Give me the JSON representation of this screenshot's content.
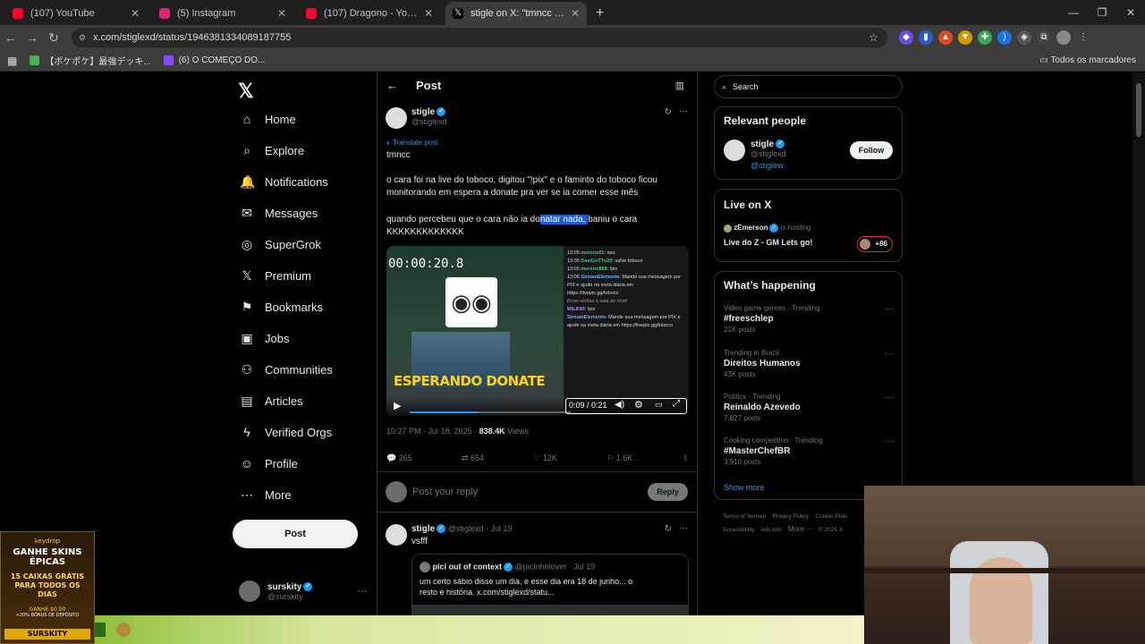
{
  "browser": {
    "tabs": [
      {
        "title": "(107) YouTube",
        "color": "#ff0033"
      },
      {
        "title": "(5) Instagram",
        "color": "#d62976"
      },
      {
        "title": "(107) Dragono - YouTube",
        "color": "#ff0033"
      },
      {
        "title": "stigle on X: \"tmncc o cara foi na",
        "color": "#000000"
      }
    ],
    "url": "x.com/stiglexd/status/1946381334089187755",
    "bookmarks": [
      "【ポケポケ】最強デッキ...",
      "(6) O COMEÇO DO..."
    ],
    "bookmarks_right": "Todos os marcadores"
  },
  "nav": {
    "items": [
      {
        "label": "Home",
        "icon": "⌂"
      },
      {
        "label": "Explore",
        "icon": "⌕"
      },
      {
        "label": "Notifications",
        "icon": "🔔"
      },
      {
        "label": "Messages",
        "icon": "✉"
      },
      {
        "label": "SuperGrok",
        "icon": "◎"
      },
      {
        "label": "Premium",
        "icon": "𝕏"
      },
      {
        "label": "Bookmarks",
        "icon": "⚑"
      },
      {
        "label": "Jobs",
        "icon": "▣"
      },
      {
        "label": "Communities",
        "icon": "⚇"
      },
      {
        "label": "Articles",
        "icon": "▤"
      },
      {
        "label": "Verified Orgs",
        "icon": "ϟ"
      },
      {
        "label": "Profile",
        "icon": "☺"
      },
      {
        "label": "More",
        "icon": "⋯"
      }
    ],
    "post_button": "Post",
    "account": {
      "name": "surskity",
      "handle": "@surskity"
    }
  },
  "header": {
    "title": "Post"
  },
  "post": {
    "name": "stigle",
    "handle": "@stiglexd",
    "translate": "Translate post",
    "line1": "tmncc",
    "line2": "o cara foi na live do toboco, digitou \"!pix\" e o faminto do toboco ficou monitorando em espera a donate pra ver se ia comer esse mês",
    "line3_pre": "quando percebeu que o cara não ia do",
    "line3_hl": "natar nada, ",
    "line3_post": "baniu o cara",
    "line4": "KKKKKKKKKKKKK",
    "video": {
      "timer": "00:00:20.8",
      "banner": "ESPERANDO DONATE",
      "time": "0:09 / 0:21",
      "progress": 0.43,
      "chat": [
        {
          "t": "13:05",
          "u": "moreno01",
          "m": "seu"
        },
        {
          "t": "13:05",
          "u": "DaviGoTTo20",
          "m": "salve toboco"
        },
        {
          "t": "13:05",
          "u": "moreno888",
          "m": "!pix"
        },
        {
          "t": "13:06",
          "u": "StreamElements",
          "m": "Mande sua mensagem por PIX e ajude na meta diária em https://livepix.gg/toboco"
        },
        {
          "t": "",
          "u": "",
          "m": "Boas-vindas à sala de chat!"
        },
        {
          "t": "",
          "u": "MILK00",
          "m": "!pix"
        },
        {
          "t": "",
          "u": "StreamElements",
          "m": "Mande sua mensagem por PIX e ajude na meta diária em https://livepix.gg/toboco"
        }
      ]
    },
    "meta_time": "10:27 PM · Jul 18, 2025 · ",
    "views_count": "838.4K",
    "views_label": " Views",
    "stats": {
      "replies": "265",
      "reposts": "654",
      "likes": "12K",
      "bookmarks": "1.6K"
    },
    "reply_placeholder": "Post your reply",
    "reply_button": "Reply"
  },
  "reply": {
    "name": "stigle",
    "handle": "@stiglexd · Jul 19",
    "text": "vsfff",
    "quote": {
      "name": "pici out of context",
      "handle": "@picInholover · Jul 19",
      "text": "um certo sábio disse um dia, e esse dia era 18 de junho... o resto é história.  x.com/stiglexd/statu..."
    }
  },
  "sidebar": {
    "search_placeholder": "Search",
    "relevant": {
      "title": "Relevant people",
      "name": "stigle",
      "handle": "@stiglexd",
      "link": "@stiglew",
      "follow": "Follow"
    },
    "live": {
      "title": "Live on X",
      "host": "zEmerson",
      "hosting": "is hosting",
      "stream": "Live do Z - GM Lets go!",
      "count": "+86"
    },
    "happening": {
      "title": "What’s happening",
      "trends": [
        {
          "cat": "Video game genres · Trending",
          "name": "#freeschlep",
          "count": "21K posts"
        },
        {
          "cat": "Trending in Brazil",
          "name": "Direitos Humanos",
          "count": "43K posts"
        },
        {
          "cat": "Politics · Trending",
          "name": "Reinaldo Azevedo",
          "count": "7,827 posts"
        },
        {
          "cat": "Cooking competition · Trending",
          "name": "#MasterChefBR",
          "count": "3,910 posts"
        }
      ],
      "show_more": "Show more"
    },
    "footer": [
      "Terms of Service",
      "Privacy Policy",
      "Cookie Polic",
      "Accessibility",
      "Ads info",
      "More ···",
      "© 2025 X"
    ]
  },
  "ad": {
    "brand": "keydrop",
    "headline": "GANHE SKINS ÉPICAS",
    "offer": "15 CAIXAS GRÁTIS PARA TODOS OS DIAS",
    "bonus": "GANHE $0.50",
    "bonus2": "+20% BÔNUS DE DEPÓSITO",
    "code": "SURSKITY"
  }
}
